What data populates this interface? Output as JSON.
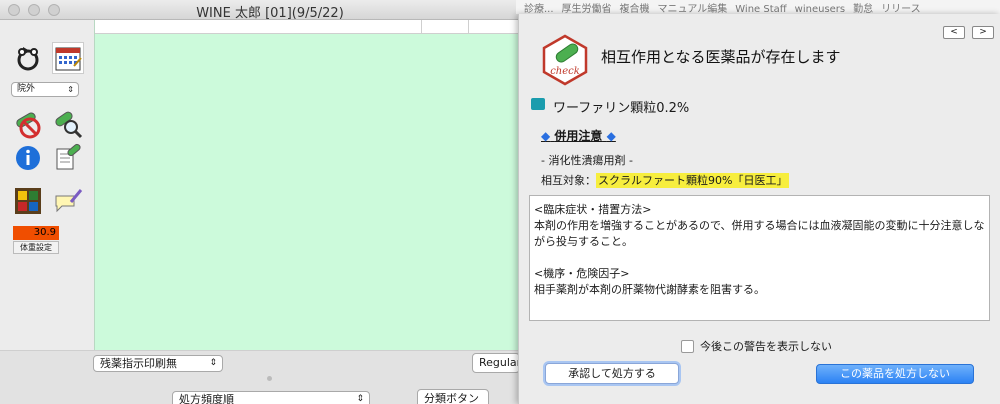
{
  "main_window": {
    "title": "WINE 太郎 [01](9/5/22)",
    "outpatient_select": "院外",
    "weight_value": "30.9",
    "weight_label": "体重設定",
    "print_select": "残薬指示印刷無",
    "font_select": "Regular",
    "sort_select": "処方頻度順",
    "category_button": "分類ボタン"
  },
  "bookmarks": [
    "診療...",
    "厚生労働省",
    "複合機",
    "マニュアル編集",
    "Wine Staff",
    "wineusers",
    "勤怠",
    "リリース"
  ],
  "dialog": {
    "prev_label": "<",
    "next_label": ">",
    "logo_text": "check",
    "title": "相互作用となる医薬品が存在します",
    "drug_name": "ワーファリン顆粒0.2%",
    "caution_label": "併用注意",
    "diamond": "◆",
    "category": "- 消化性潰瘍用剤 -",
    "target_prefix": "相互対象：",
    "target_drug": "スクラルファート顆粒90%「日医工」",
    "details": {
      "heading1": "<臨床症状・措置方法>",
      "text1": "本剤の作用を増強することがあるので、併用する場合には血液凝固能の変動に十分注意しながら投与すること。",
      "heading2": "<機序・危険因子>",
      "text2": "相手薬剤が本剤の肝薬物代謝酵素を阻害する。"
    },
    "suppress_checkbox": "今後この警告を表示しない",
    "approve_button": "承認して処方する",
    "deny_button": "この薬品を処方しない"
  },
  "colors": {
    "content_bg": "#ccfadb",
    "weight_bg": "#f04e00",
    "drug_swatch": "#1a9cad",
    "highlight": "#f7ee3e",
    "primary_button": "#2c82f4"
  }
}
